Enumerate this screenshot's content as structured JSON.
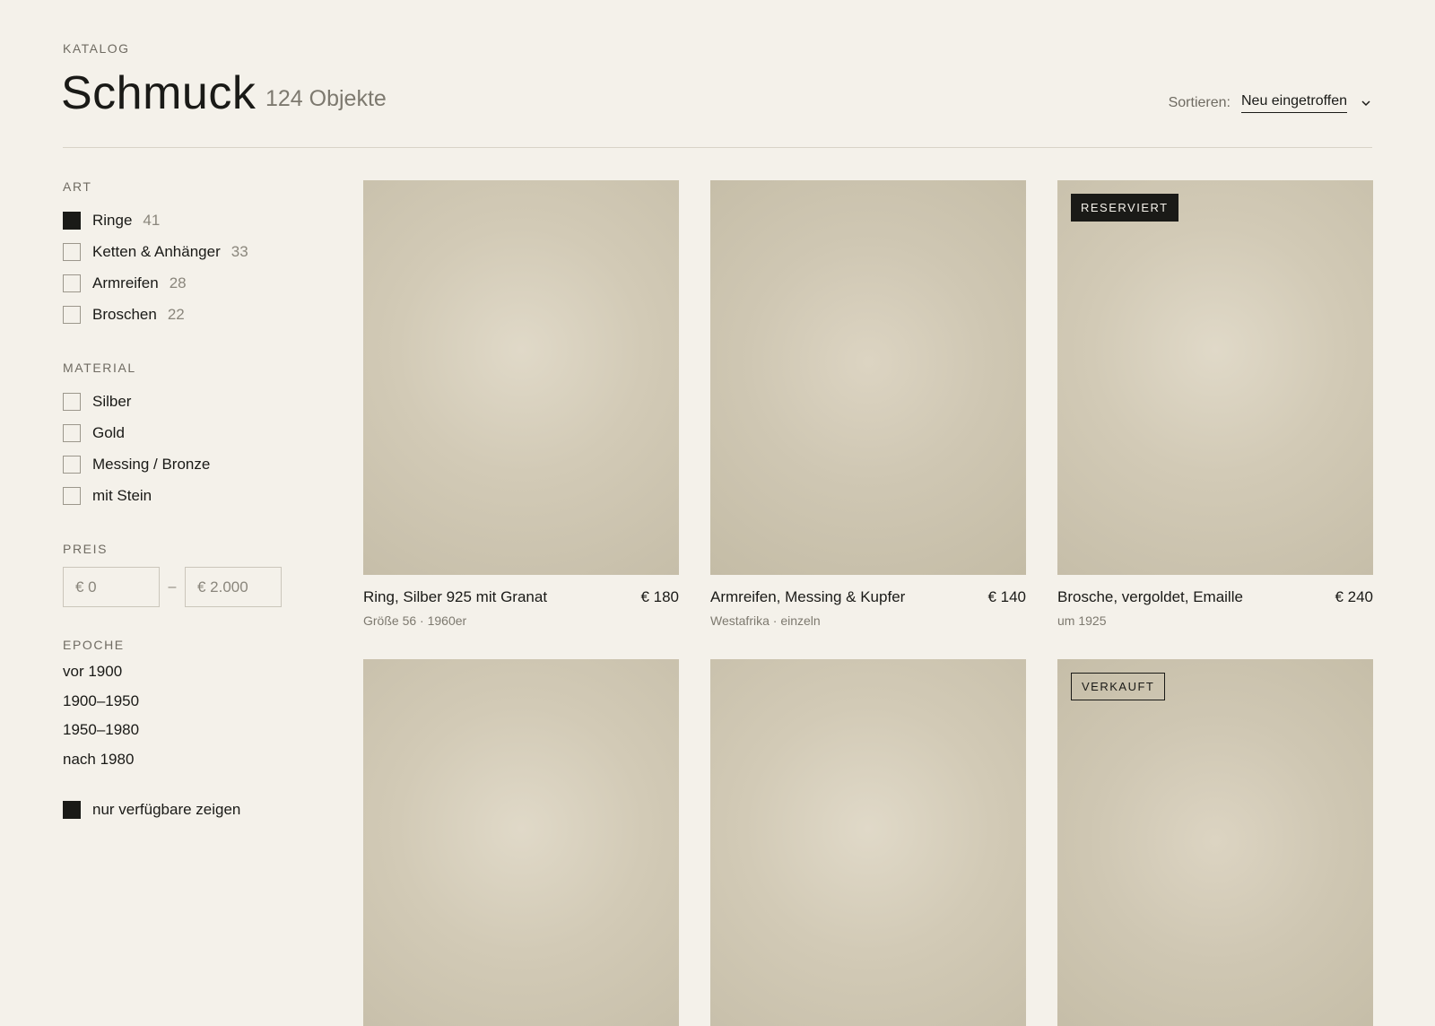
{
  "header": {
    "eyebrow": "KATALOG",
    "title": "Schmuck",
    "count": "124 Objekte",
    "sort_label": "Sortieren:",
    "sort_value": "Neu eingetroffen",
    "sort_icon": "chevron-down-icon"
  },
  "filters": {
    "art": {
      "heading": "ART",
      "items": [
        {
          "label": "Ringe",
          "count": "41",
          "checked": true
        },
        {
          "label": "Ketten & Anhänger",
          "count": "33",
          "checked": false
        },
        {
          "label": "Armreifen",
          "count": "28",
          "checked": false
        },
        {
          "label": "Broschen",
          "count": "22",
          "checked": false
        }
      ]
    },
    "material": {
      "heading": "MATERIAL",
      "items": [
        {
          "label": "Silber",
          "checked": false
        },
        {
          "label": "Gold",
          "checked": false
        },
        {
          "label": "Messing / Bronze",
          "checked": false
        },
        {
          "label": "mit Stein",
          "checked": false
        }
      ]
    },
    "preis": {
      "heading": "PREIS",
      "min_placeholder": "€ 0",
      "max_placeholder": "€ 2.000",
      "separator": "–"
    },
    "epoche": {
      "heading": "EPOCHE",
      "items": [
        "vor 1900",
        "1900–1950",
        "1950–1980",
        "nach 1980"
      ]
    },
    "available_only": {
      "label": "nur verfügbare zeigen",
      "checked": true
    }
  },
  "products": [
    {
      "name": "Ring, Silber 925 mit Granat",
      "price": "€ 180",
      "sub": "Größe 56 · 1960er",
      "badge": ""
    },
    {
      "name": "Armreifen, Messing & Kupfer",
      "price": "€ 140",
      "sub": "Westafrika · einzeln",
      "badge": ""
    },
    {
      "name": "Brosche, vergoldet, Emaille",
      "price": "€ 240",
      "sub": "um 1925",
      "badge": "RESERVIERT",
      "badge_style": "dark"
    },
    {
      "name": "",
      "price": "",
      "sub": "",
      "badge": ""
    },
    {
      "name": "",
      "price": "",
      "sub": "",
      "badge": ""
    },
    {
      "name": "",
      "price": "",
      "sub": "",
      "badge": "VERKAUFT",
      "badge_style": "outline"
    }
  ],
  "colors": {
    "background": "#f4f1ea",
    "ink": "#1a1a17",
    "muted": "#7d796f",
    "image_placeholder": "#d2cab6"
  }
}
